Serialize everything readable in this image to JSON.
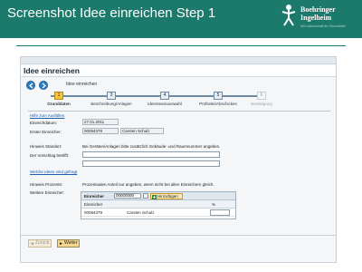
{
  "slide": {
    "title": "Screenshot Idee einreichen Step 1",
    "logo_name": "Boehringer\nIngelheim",
    "logo_tagline": "Mit Leidenschaft für Gesundheit",
    "header_color": "#1b7a6b"
  },
  "app": {
    "window_title": "Idee einreichen",
    "nav": {
      "back_icon": "arrow-left-icon",
      "forward_icon": "arrow-right-icon",
      "label": "Idee einreichen"
    },
    "roadmap": [
      {
        "number": "1",
        "label": "Grunddaten",
        "state": "active"
      },
      {
        "number": "3",
        "label": "Beschreibung/Anlagen",
        "state": "normal"
      },
      {
        "number": "4",
        "label": "Ideenteamauswahl",
        "state": "normal"
      },
      {
        "number": "5",
        "label": "Prüfseite/Abschicken",
        "state": "normal"
      },
      {
        "number": "6",
        "label": "Bestätigung",
        "state": "disabled"
      }
    ],
    "help_link": "Hilfe zum Ausfüllen",
    "form": {
      "einreichdatum_label": "Einreichdatum:",
      "einreichdatum_value": "27.01.2011",
      "erster_einreicher_label": "Erster Einreicher:",
      "erster_einreicher_id": "00084379",
      "erster_einreicher_name": "Carsten Schulz",
      "hinweis_standort_label": "Hinweis Standort:",
      "hinweis_standort_text": "Bei Geräten/Anlagen bitte zusätzlich Gebäude- und Raumnummer angeben.",
      "vorschlag_label": "Der Vorschlag betrifft:",
      "vorschlag_value": "",
      "vorschlag_value2": "",
      "ideas_link": "Welche Ideen sind gefragt",
      "hinweis_prozente_label": "Hinweis Prozente:",
      "hinweis_prozente_text": "Prozentualen Anteil nur angeben, wenn nicht bei allen Einreichern gleich.",
      "weitere_label": "Weitere Einreicher:"
    },
    "einreicher_table": {
      "input_label": "Einreicher",
      "input_value": "00000000",
      "add_button": "Hinzufügen",
      "columns": [
        "Einreicher",
        "%"
      ],
      "rows": [
        {
          "id": "00084379",
          "name": "Carsten Schulz",
          "percent": ""
        }
      ]
    },
    "buttons": {
      "back": "Zurück",
      "next": "Weiter"
    }
  }
}
